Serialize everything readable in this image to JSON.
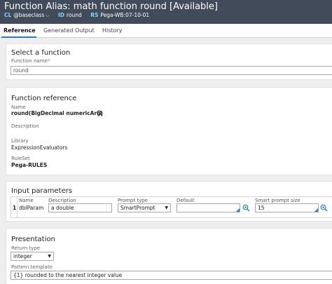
{
  "header": {
    "title": "Function Alias: math function round [Available]",
    "meta": {
      "cl_key": "CL",
      "cl_value": "@baseclass",
      "id_key": "ID",
      "id_value": "round",
      "rs_key": "RS",
      "rs_value": "Pega-WB:07-10-01"
    }
  },
  "tabs": [
    {
      "label": "Reference",
      "active": true
    },
    {
      "label": "Generated Output",
      "active": false
    },
    {
      "label": "History",
      "active": false
    }
  ],
  "select_function": {
    "title": "Select a function",
    "field_label": "Function name",
    "required_mark": "*",
    "value": "round"
  },
  "function_reference": {
    "title": "Function reference",
    "name_label": "Name",
    "name_value": "round(BigDecimal numericArg)",
    "description_label": "Description",
    "library_label": "Library",
    "library_value": "ExpressionEvaluators",
    "ruleset_label": "RuleSet",
    "ruleset_value": "Pega-RULES"
  },
  "input_parameters": {
    "title": "Input parameters",
    "columns": {
      "name": "Name",
      "description": "Description",
      "prompt_type": "Prompt type",
      "default": "Default",
      "smart_prompt_size": "Smart prompt size"
    },
    "rows": [
      {
        "index": "1",
        "name": "dblParam",
        "description": "a double",
        "prompt_type": "SmartPrompt",
        "default": "",
        "smart_prompt_size": "15"
      }
    ]
  },
  "presentation": {
    "title": "Presentation",
    "return_type_label": "Return type",
    "return_type_value": "integer",
    "pattern_label": "Pattern template",
    "pattern_value": "{1} rounded to the nearest integer value"
  },
  "colors": {
    "header_bg": "#414b59",
    "header_key": "#7fd6f5",
    "accent": "#2b7bd6",
    "required": "#e0601b"
  },
  "icons": {
    "cl_dropdown": "chevron-down-icon",
    "name_lookup": "magnifier-icon",
    "default_lookup": "magnifier-plus-icon",
    "size_lookup": "magnifier-plus-icon",
    "select_arrow": "triangle-down-icon"
  }
}
